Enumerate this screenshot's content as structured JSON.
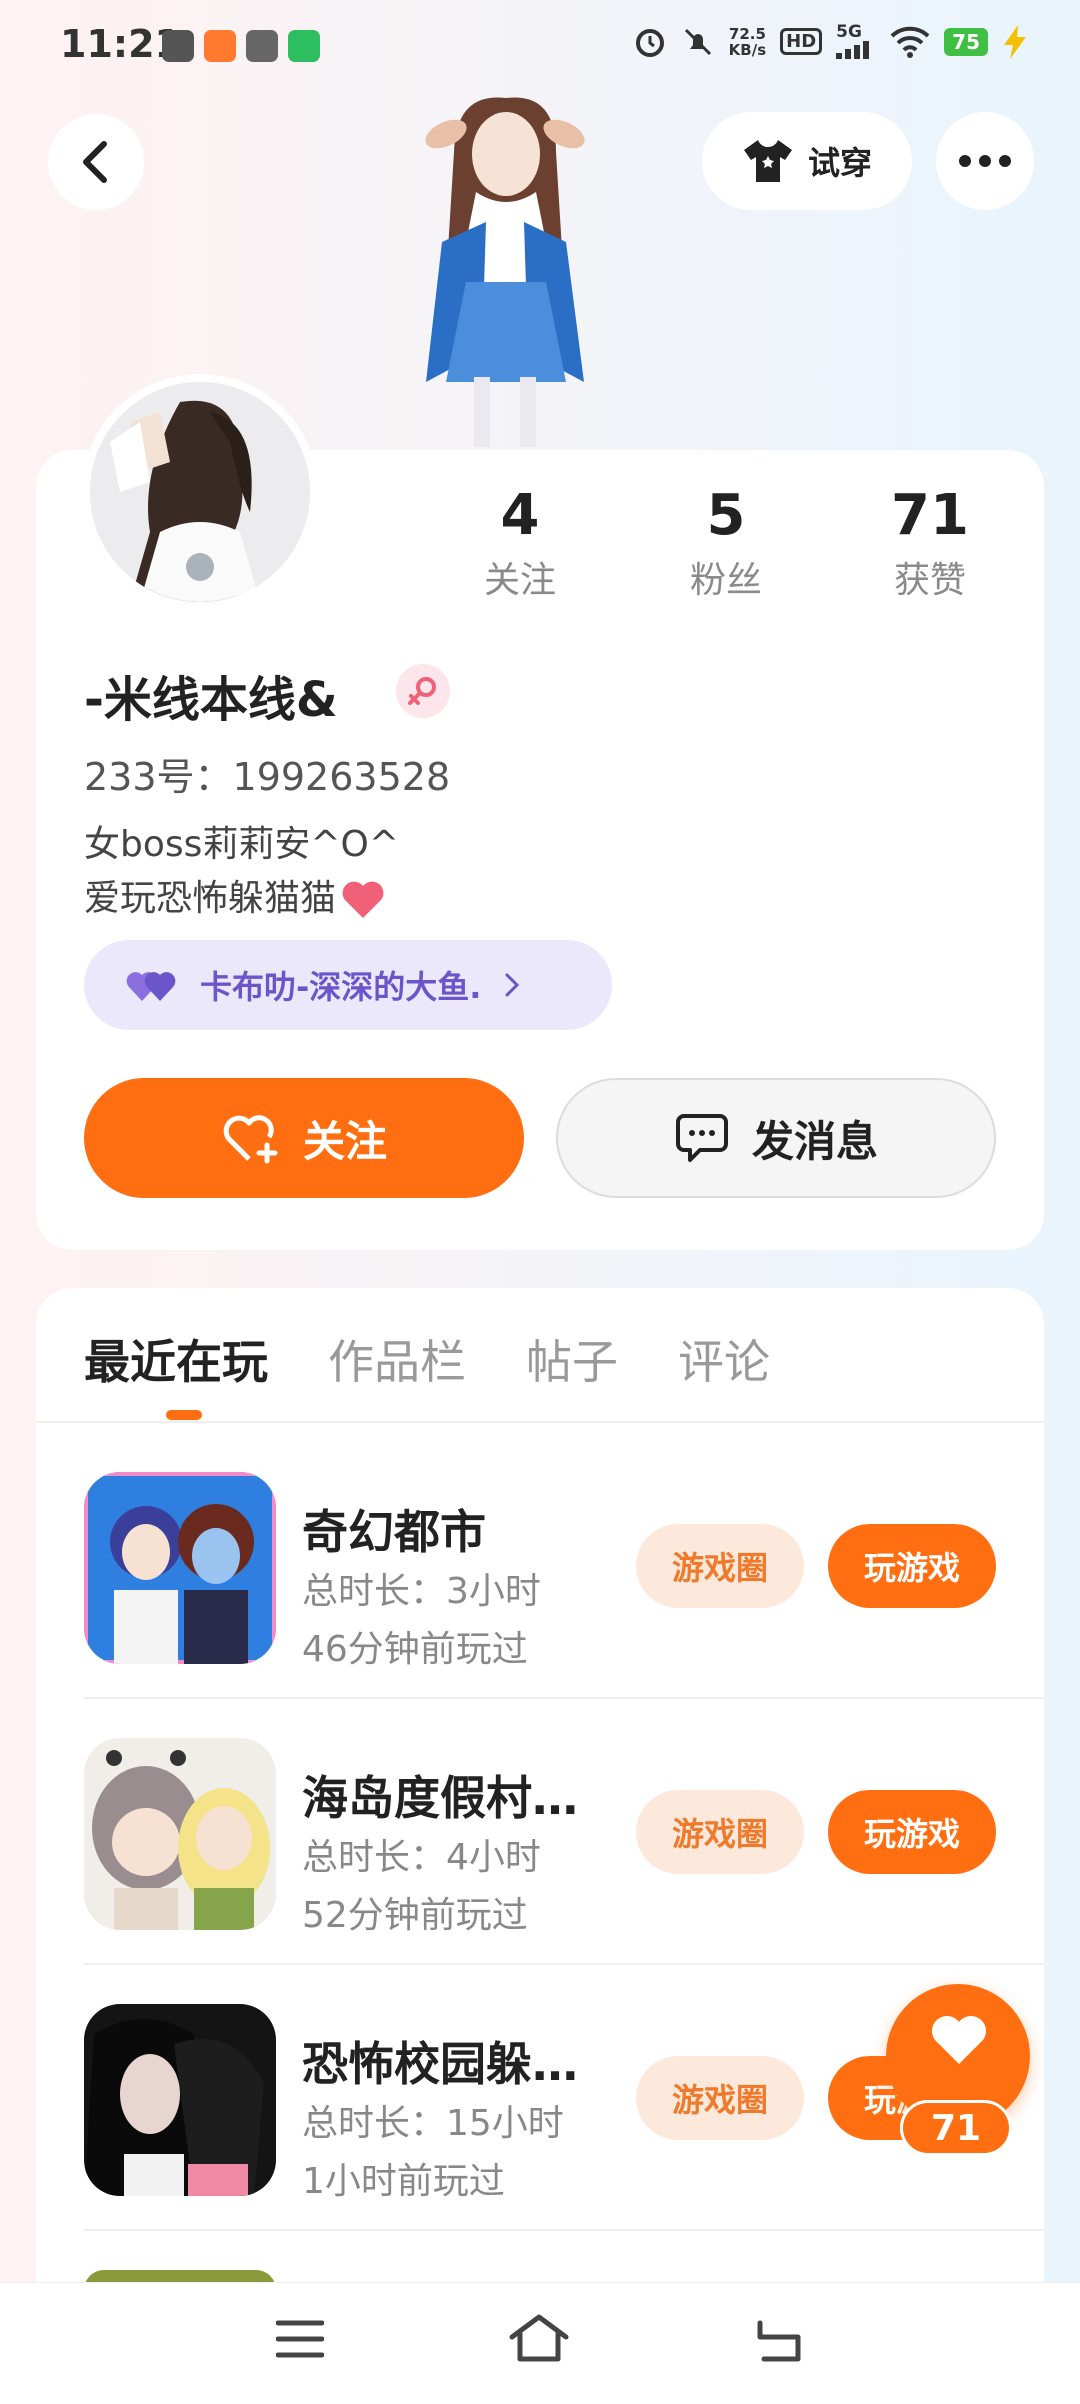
{
  "status_bar": {
    "time": "11:21",
    "net_speed_value": "72.5",
    "net_speed_unit": "KB/s",
    "hd": "HD",
    "network": "5G",
    "battery": "75"
  },
  "header": {
    "try_on_label": "试穿"
  },
  "profile": {
    "stats": [
      {
        "value": "4",
        "label": "关注"
      },
      {
        "value": "5",
        "label": "粉丝"
      },
      {
        "value": "71",
        "label": "获赞"
      }
    ],
    "nickname": "-米线本线&",
    "uid": "233号：199263528",
    "bio_line1": "女boss莉莉安^O^",
    "bio_line2": "爱玩恐怖躲猫猫",
    "relation": "卡布叻-深深的大鱼.",
    "follow_label": "关注",
    "message_label": "发消息"
  },
  "tabs": [
    "最近在玩",
    "作品栏",
    "帖子",
    "评论"
  ],
  "games": [
    {
      "name": "奇幻都市",
      "total_time": "总时长：3小时",
      "last_played": "46分钟前玩过",
      "circle_label": "游戏圈",
      "play_label": "玩游戏"
    },
    {
      "name": "海岛度假村…",
      "total_time": "总时长：4小时",
      "last_played": "52分钟前玩过",
      "circle_label": "游戏圈",
      "play_label": "玩游戏"
    },
    {
      "name": "恐怖校园躲…",
      "total_time": "总时长：15小时",
      "last_played": "1小时前玩过",
      "circle_label": "游戏圈",
      "play_label": "玩游戏"
    }
  ],
  "like_fab": {
    "count": "71"
  },
  "colors": {
    "accent": "#ff6f12",
    "relation_text": "#6a55c9",
    "gender": "#f06178"
  }
}
